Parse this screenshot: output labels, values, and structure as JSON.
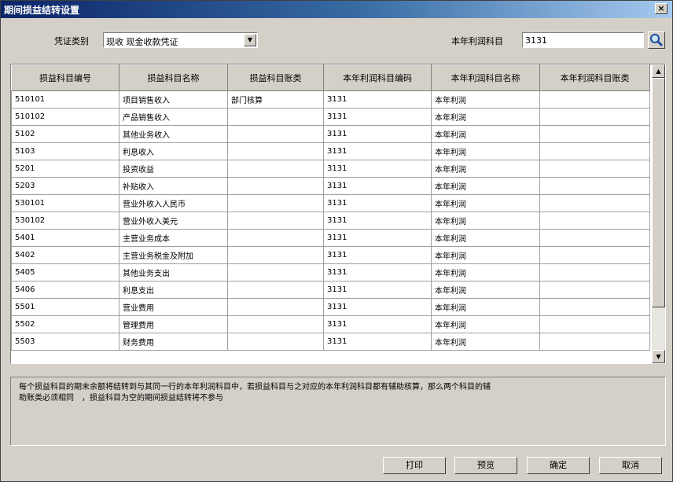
{
  "window": {
    "title": "期间损益结转设置",
    "close_glyph": "×"
  },
  "voucher": {
    "label": "凭证类别",
    "value": "现收 现金收款凭证"
  },
  "profit_account": {
    "label": "本年利润科目",
    "value": "3131"
  },
  "table": {
    "columns": [
      "损益科目编号",
      "损益科目名称",
      "损益科目账类",
      "本年利润科目编码",
      "本年利润科目名称",
      "本年利润科目账类"
    ],
    "rows": [
      [
        "510101",
        "项目销售收入",
        "部门核算",
        "3131",
        "本年利润",
        ""
      ],
      [
        "510102",
        "产品销售收入",
        "",
        "3131",
        "本年利润",
        ""
      ],
      [
        "5102",
        "其他业务收入",
        "",
        "3131",
        "本年利润",
        ""
      ],
      [
        "5103",
        "利息收入",
        "",
        "3131",
        "本年利润",
        ""
      ],
      [
        "5201",
        "投资收益",
        "",
        "3131",
        "本年利润",
        ""
      ],
      [
        "5203",
        "补贴收入",
        "",
        "3131",
        "本年利润",
        ""
      ],
      [
        "530101",
        "营业外收入人民币",
        "",
        "3131",
        "本年利润",
        ""
      ],
      [
        "530102",
        "营业外收入美元",
        "",
        "3131",
        "本年利润",
        ""
      ],
      [
        "5401",
        "主营业务成本",
        "",
        "3131",
        "本年利润",
        ""
      ],
      [
        "5402",
        "主营业务税金及附加",
        "",
        "3131",
        "本年利润",
        ""
      ],
      [
        "5405",
        "其他业务支出",
        "",
        "3131",
        "本年利润",
        ""
      ],
      [
        "5406",
        "利息支出",
        "",
        "3131",
        "本年利润",
        ""
      ],
      [
        "5501",
        "营业费用",
        "",
        "3131",
        "本年利润",
        ""
      ],
      [
        "5502",
        "管理费用",
        "",
        "3131",
        "本年利润",
        ""
      ],
      [
        "5503",
        "财务费用",
        "",
        "3131",
        "本年利润",
        ""
      ]
    ]
  },
  "help_text": [
    "每个损益科目的期末余额将结转到与其同一行的本年利润科目中，若损益科目与之对应的本年利润科目都有辅助核算，那么两个科目的辅",
    "助账类必须相同　，损益科目为空的期间损益结转将不参与"
  ],
  "buttons": {
    "print": "打印",
    "preview": "预览",
    "ok": "确定",
    "cancel": "取消"
  }
}
